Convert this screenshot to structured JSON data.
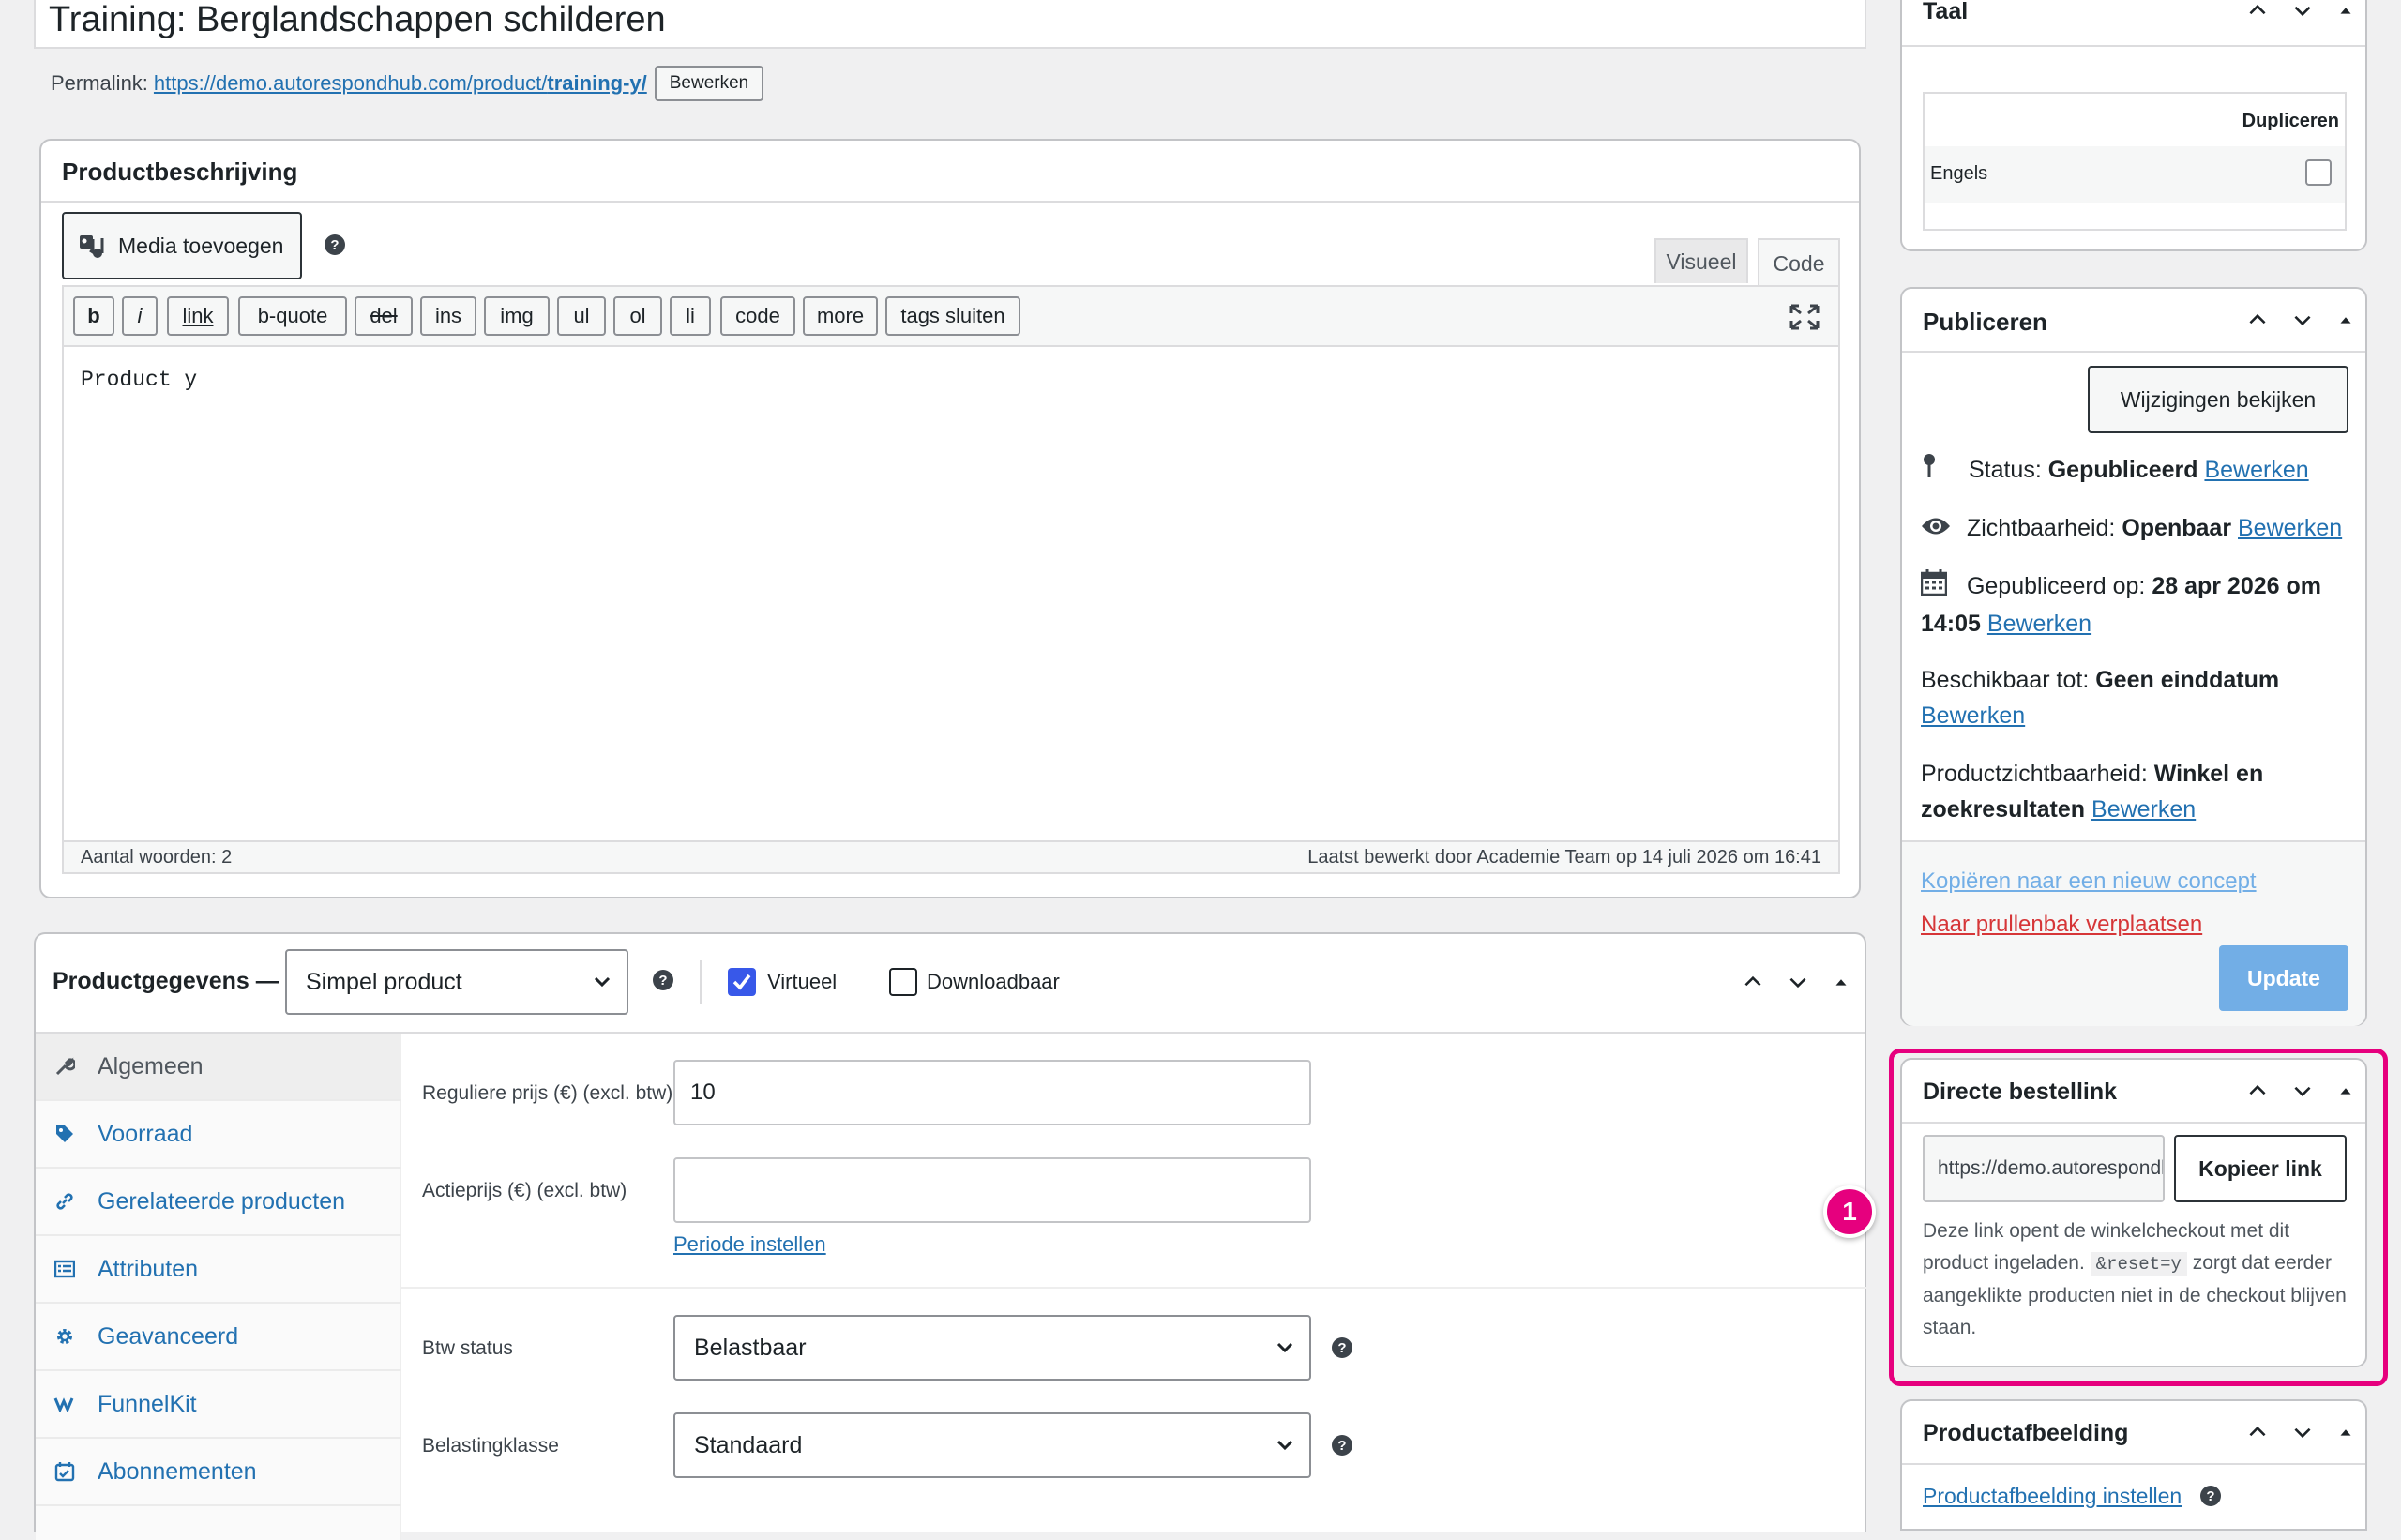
{
  "title_value": "Training: Berglandschappen schilderen",
  "permalink": {
    "label": "Permalink:",
    "url_prefix": "https://demo.autorespondhub.com/product/",
    "url_slug": "training-y/",
    "edit_button": "Bewerken"
  },
  "description": {
    "title": "Productbeschrijving",
    "media_button": "Media toevoegen",
    "tab_visual": "Visueel",
    "tab_code": "Code",
    "quicktags": [
      "b",
      "i",
      "link",
      "b-quote",
      "del",
      "ins",
      "img",
      "ul",
      "ol",
      "li",
      "code",
      "more",
      "tags sluiten"
    ],
    "content": "Product y",
    "word_count": "Aantal woorden: 2",
    "last_edited": "Laatst bewerkt door Academie Team op 14 juli 2026 om 16:41"
  },
  "product_data": {
    "title": "Productgegevens —",
    "type_select": "Simpel product",
    "virtual_label": "Virtueel",
    "virtual_checked": true,
    "downloadable_label": "Downloadbaar",
    "downloadable_checked": false,
    "tabs": [
      {
        "label": "Algemeen",
        "icon": "wrench-icon",
        "active": true
      },
      {
        "label": "Voorraad",
        "icon": "tag-icon"
      },
      {
        "label": "Gerelateerde producten",
        "icon": "link-icon"
      },
      {
        "label": "Attributen",
        "icon": "list-icon"
      },
      {
        "label": "Geavanceerd",
        "icon": "gear-icon"
      },
      {
        "label": "FunnelKit",
        "icon": "funnelkit-icon"
      },
      {
        "label": "Abonnementen",
        "icon": "calendar-check-icon"
      }
    ],
    "regular_price_label": "Reguliere prijs (€) (excl. btw)",
    "regular_price_value": "10",
    "sale_price_label": "Actieprijs (€) (excl. btw)",
    "sale_price_value": "",
    "schedule_link": "Periode instellen",
    "tax_status_label": "Btw status",
    "tax_status_value": "Belastbaar",
    "tax_class_label": "Belastingklasse",
    "tax_class_value": "Standaard"
  },
  "language": {
    "title": "Taal",
    "column_header": "Dupliceren",
    "row_label": "Engels",
    "row_checked": false
  },
  "publish": {
    "title": "Publiceren",
    "preview_button": "Wijzigingen bekijken",
    "status_label": "Status:",
    "status_value": "Gepubliceerd",
    "visibility_label": "Zichtbaarheid:",
    "visibility_value": "Openbaar",
    "published_label": "Gepubliceerd op:",
    "published_value_1": "28 apr 2026 om",
    "published_value_2": "14:05",
    "available_label": "Beschikbaar tot:",
    "available_value": "Geen einddatum",
    "catalog_label": "Productzichtbaarheid:",
    "catalog_value_1": "Winkel en",
    "catalog_value_2": "zoekresultaten",
    "edit_link": "Bewerken",
    "copy_draft_link": "Kopiëren naar een nieuw concept",
    "trash_link": "Naar prullenbak verplaatsen",
    "update_button": "Update"
  },
  "direct_link": {
    "title": "Directe bestellink",
    "url_value": "https://demo.autorespondhub.com/checkout/?add-to-cart=y&reset=y",
    "copy_button": "Kopieer link",
    "desc_part1": "Deze link opent de winkelcheckout met dit product ingeladen.",
    "desc_code": "&reset=y",
    "desc_part2": "zorgt dat eerder aangeklikte producten niet in de checkout blijven staan.",
    "badge": "1"
  },
  "product_image": {
    "title": "Productafbeelding",
    "set_link": "Productafbeelding instellen"
  },
  "colors": {
    "accent": "#2271b1",
    "highlight": "#e6007e",
    "trash": "#d63638",
    "update_button": "#72aee6",
    "checkbox_checked": "#3858e9"
  }
}
